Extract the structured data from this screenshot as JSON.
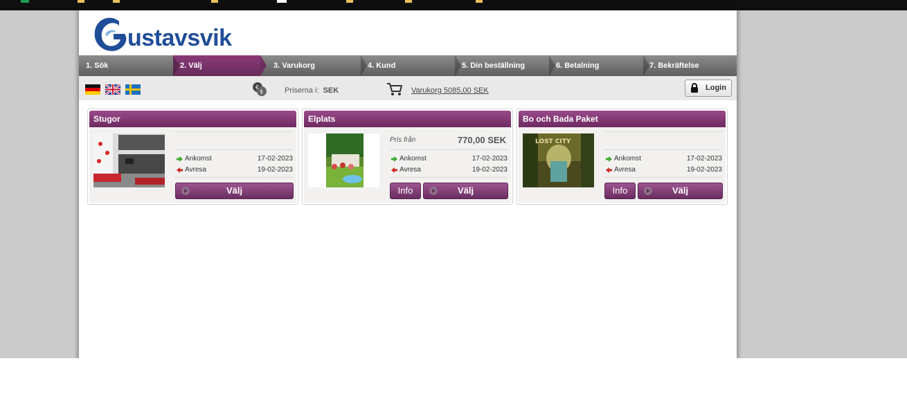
{
  "brand": {
    "logo_text": "ustavsvik"
  },
  "steps": [
    {
      "label": "1. Sök",
      "active": false
    },
    {
      "label": "2. Välj",
      "active": true
    },
    {
      "label": "3. Varukorg",
      "active": false
    },
    {
      "label": "4. Kund",
      "active": false
    },
    {
      "label": "5. Din beställning",
      "active": false
    },
    {
      "label": "6. Betalning",
      "active": false
    },
    {
      "label": "7. Bekräftelse",
      "active": false
    }
  ],
  "infobar": {
    "languages": [
      "german-flag",
      "uk-flag",
      "swedish-flag"
    ],
    "prices_label": "Priserna i:",
    "currency": "SEK",
    "cart_link": "Varukorg 5085,00 SEK",
    "login_label": "Login"
  },
  "cards": [
    {
      "title": "Stugor",
      "image": "kitchen-interior-photo",
      "price_from_label": "",
      "price": "",
      "arrival_label": "Ankomst",
      "arrival_date": "17-02-2023",
      "departure_label": "Avresa",
      "departure_date": "19-02-2023",
      "info_label": "",
      "select_label": "Välj"
    },
    {
      "title": "Elplats",
      "image": "camping-pitch-photo",
      "price_from_label": "Pris från",
      "price": "770,00 SEK",
      "arrival_label": "Ankomst",
      "arrival_date": "17-02-2023",
      "departure_label": "Avresa",
      "departure_date": "19-02-2023",
      "info_label": "Info",
      "select_label": "Välj"
    },
    {
      "title": "Bo och Bada Paket",
      "image": "lost-city-jungle-photo",
      "image_text": "LOST CITY",
      "price_from_label": "",
      "price": "",
      "arrival_label": "Ankomst",
      "arrival_date": "17-02-2023",
      "departure_label": "Avresa",
      "departure_date": "19-02-2023",
      "info_label": "Info",
      "select_label": "Välj"
    }
  ],
  "colors": {
    "accent": "#7a3370",
    "header_bar": "#6f6f6f",
    "logo_blue": "#1f4d98"
  }
}
